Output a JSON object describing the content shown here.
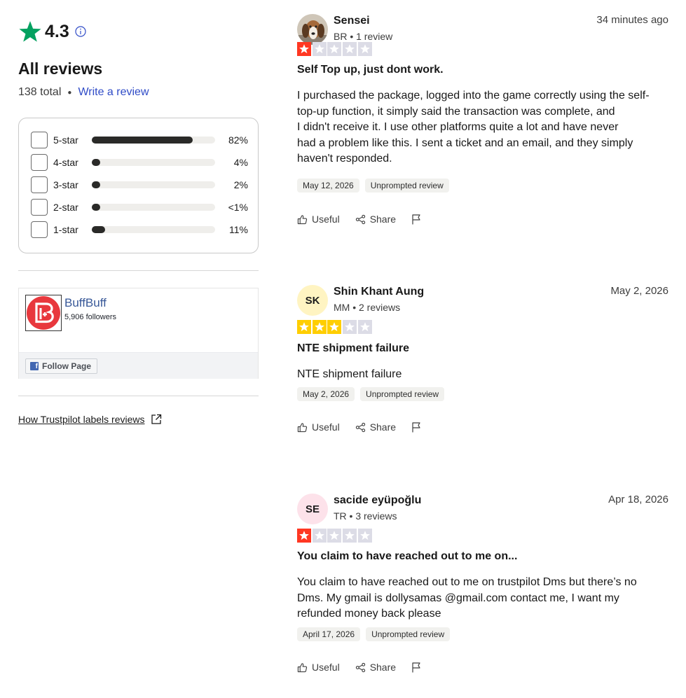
{
  "summary": {
    "score": "4.3",
    "all_reviews_title": "All reviews",
    "total": "138 total",
    "write_review": "Write a review",
    "colors": {
      "trust_green": "#04a160",
      "link_blue": "#2f4bc7"
    }
  },
  "distribution": [
    {
      "label": "5-star",
      "percent_text": "82%",
      "percent": 82
    },
    {
      "label": "4-star",
      "percent_text": "4%",
      "percent": 4
    },
    {
      "label": "3-star",
      "percent_text": "2%",
      "percent": 2
    },
    {
      "label": "2-star",
      "percent_text": "<1%",
      "percent": 1
    },
    {
      "label": "1-star",
      "percent_text": "11%",
      "percent": 11
    }
  ],
  "facebook": {
    "page_name": "BuffBuff",
    "followers": "5,906 followers",
    "follow_label": "Follow Page"
  },
  "how_labels": "How Trustpilot labels reviews",
  "reviews": [
    {
      "name": "Sensei",
      "meta": "BR • 1 review",
      "date": "34 minutes ago",
      "initials": "",
      "avatar_icon": "dog-photo-icon",
      "rating": 1,
      "star_color": "#ff3722",
      "title": "Self Top up, just dont work.",
      "body": [
        "I purchased the package, logged into the game correctly using the self-",
        "top-up function, it simply said the transaction was complete, and",
        "I didn't receive it. I use other platforms quite a lot and have never",
        "had a problem like this. I sent a ticket and an email, and they simply",
        "haven't responded."
      ],
      "experience_date": "May 12, 2026",
      "label": "Unprompted review",
      "useful": "Useful",
      "share": "Share"
    },
    {
      "name": "Shin Khant Aung",
      "meta": "MM • 2 reviews",
      "date": "May 2, 2026",
      "initials": "SK",
      "avatar_color": "#fff4c2",
      "rating": 3,
      "star_color": "#ffce00",
      "title": "NTE shipment failure",
      "body": [
        "NTE shipment failure"
      ],
      "experience_date": "May 2, 2026",
      "label": "Unprompted review",
      "useful": "Useful",
      "share": "Share"
    },
    {
      "name": "sacide eyüpoğlu",
      "meta": "TR • 3 reviews",
      "date": "Apr 18, 2026",
      "initials": "SE",
      "avatar_color": "#fde2ea",
      "rating": 1,
      "star_color": "#ff3722",
      "title": "You claim to have reached out to me on...",
      "body": [
        "You claim to have reached out to me on trustpilot Dms but there’s no",
        "Dms. My gmail is dollysamas @gmail.com contact me, I want my",
        "refunded money back please"
      ],
      "experience_date": "April 17, 2026",
      "label": "Unprompted review",
      "useful": "Useful",
      "share": "Share"
    }
  ]
}
